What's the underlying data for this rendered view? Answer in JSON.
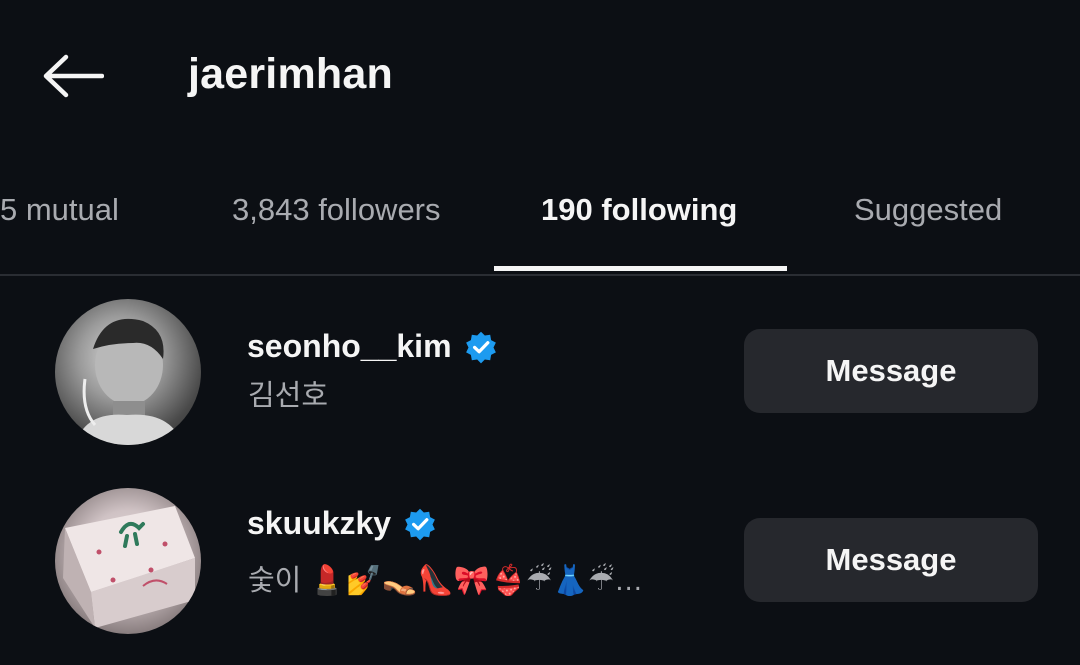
{
  "header": {
    "title": "jaerimhan"
  },
  "tabs": [
    {
      "label": "5 mutual",
      "active": false
    },
    {
      "label": "3,843 followers",
      "active": false
    },
    {
      "label": "190 following",
      "active": true
    },
    {
      "label": "Suggested",
      "active": false
    }
  ],
  "accounts": [
    {
      "username": "seonho__kim",
      "verified": true,
      "subtitle": "김선호",
      "button_label": "Message"
    },
    {
      "username": "skuukzky",
      "verified": true,
      "subtitle": "숯이 💄💅👡👠🎀👙☔👗☔…",
      "button_label": "Message"
    }
  ],
  "colors": {
    "background": "#0c0f14",
    "text_primary": "#f5f5f5",
    "text_secondary": "#a9abb0",
    "button_bg": "#26282d",
    "verified_blue": "#1d9bf0",
    "divider": "#2a2d33"
  },
  "icons": {
    "back": "arrow-left-icon",
    "verified": "verified-badge-icon"
  }
}
